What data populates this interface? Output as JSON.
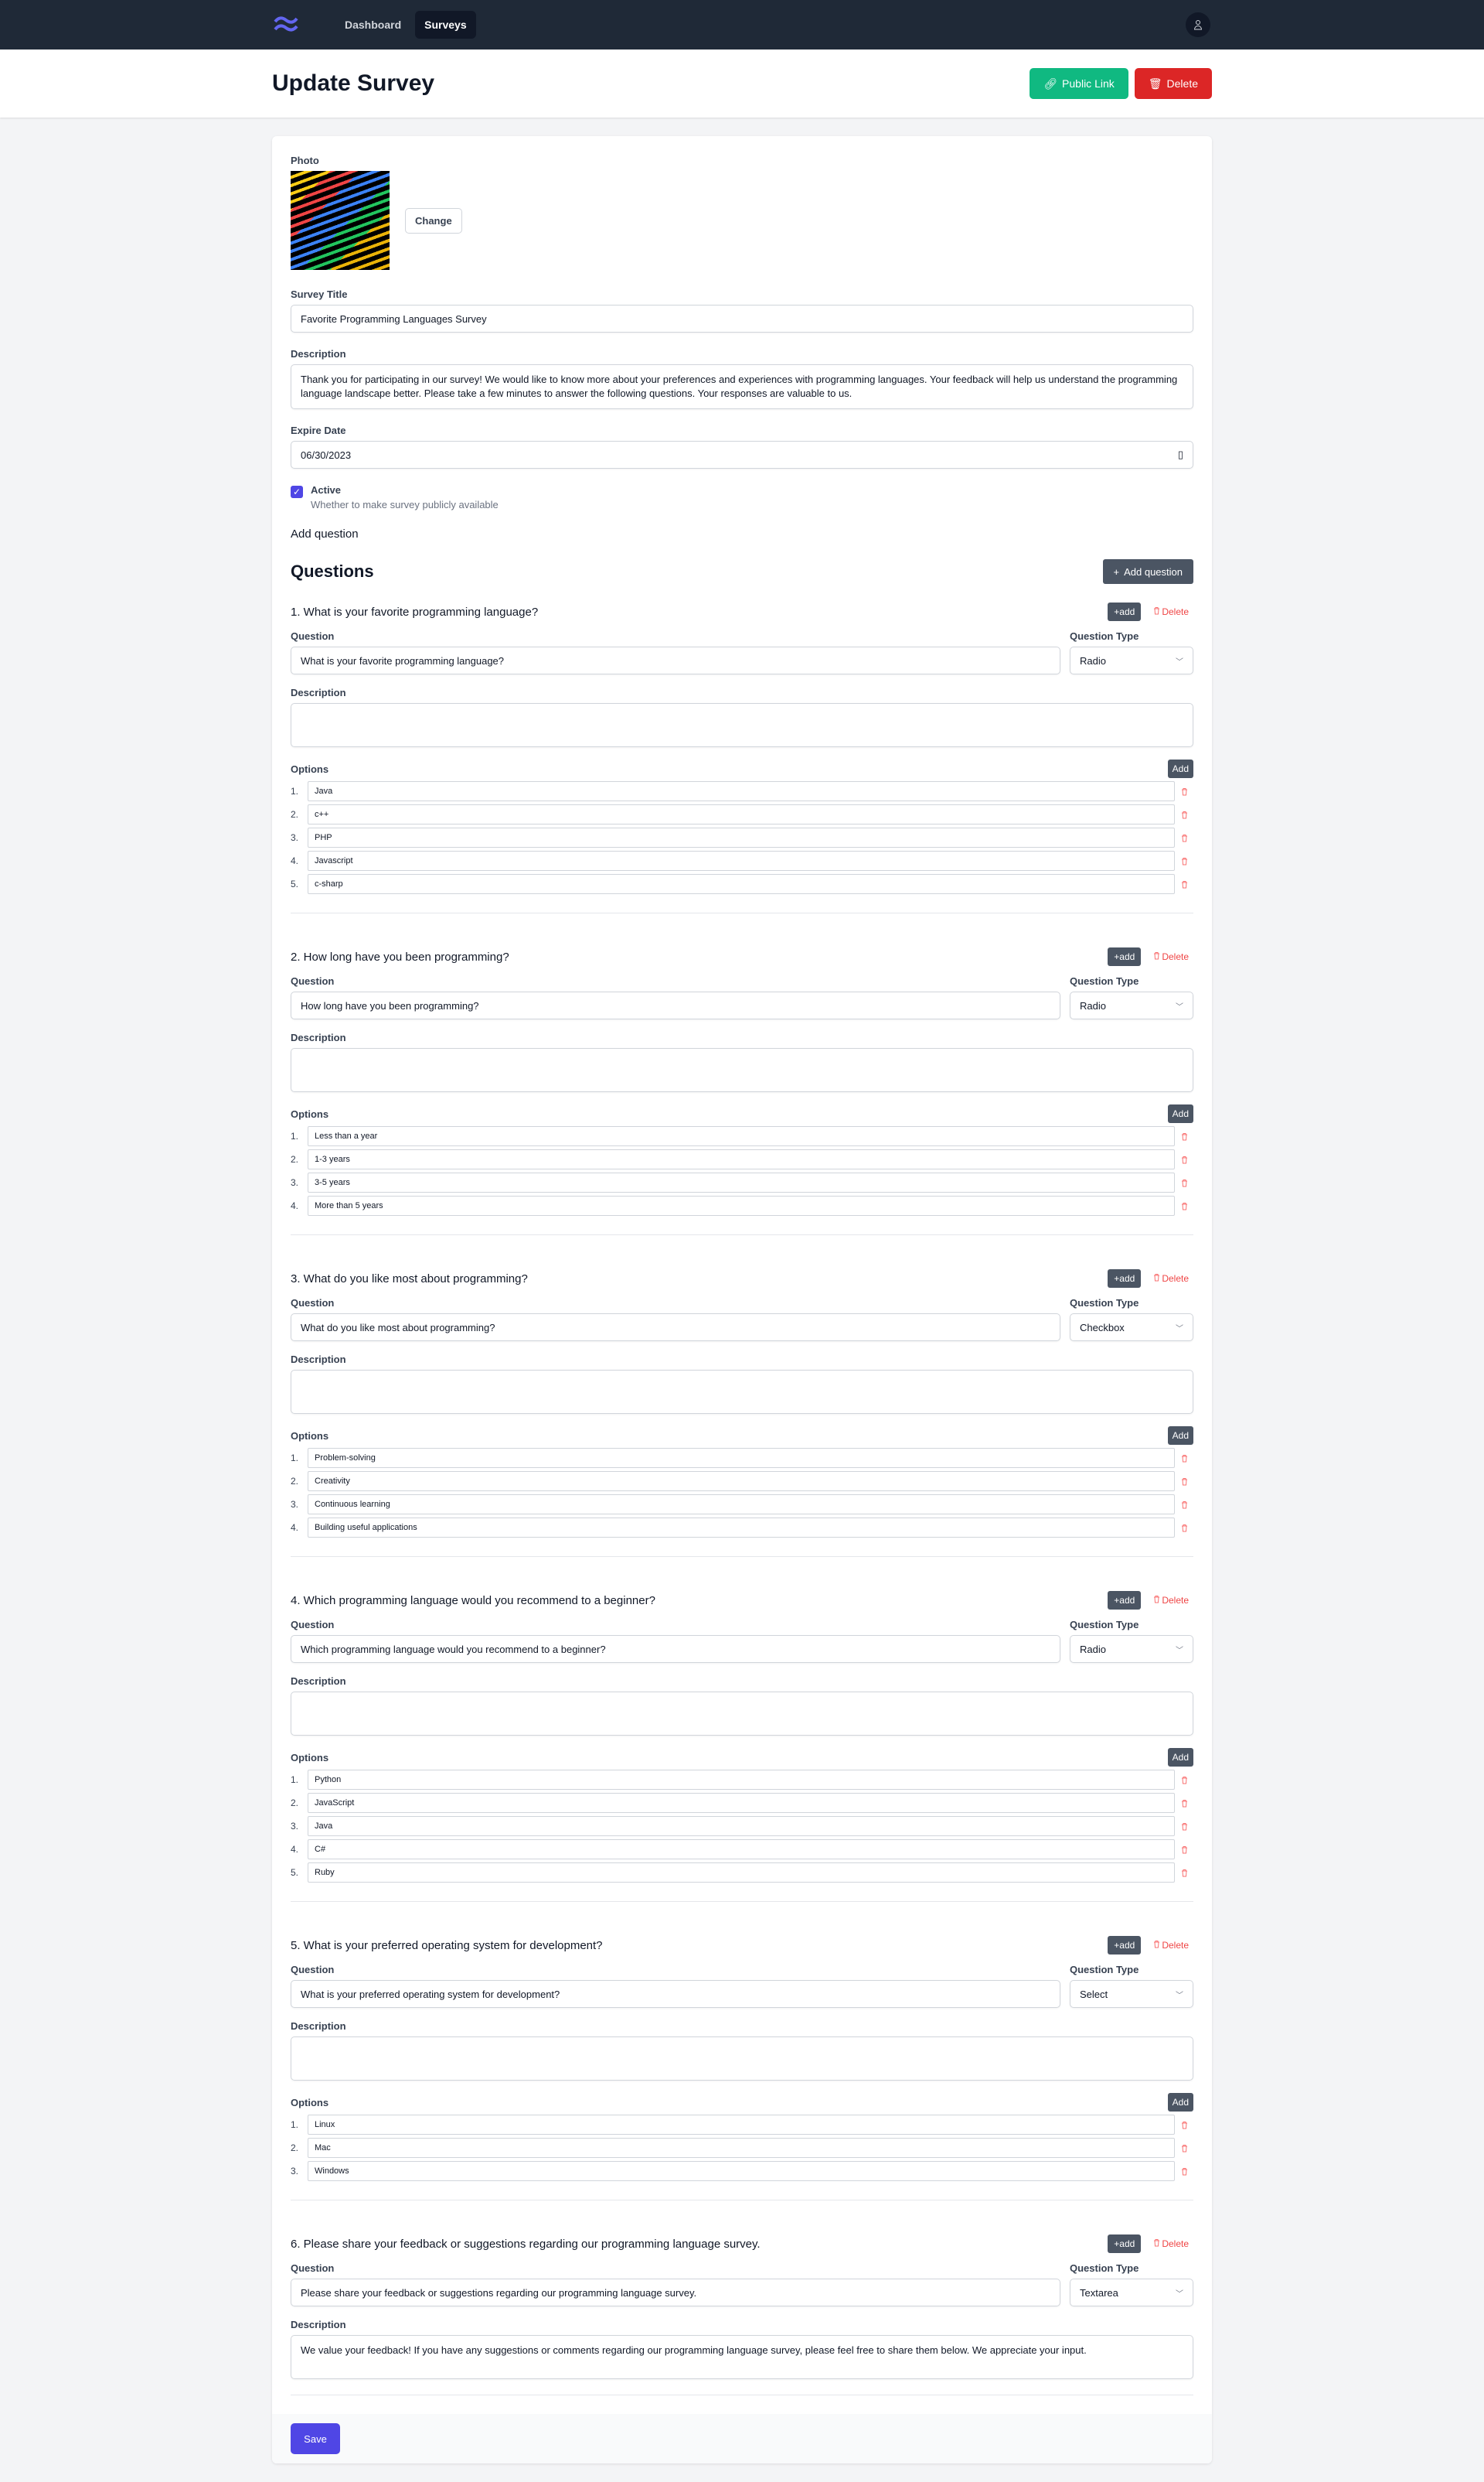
{
  "nav": {
    "items": [
      {
        "label": "Dashboard",
        "active": false
      },
      {
        "label": "Surveys",
        "active": true
      }
    ]
  },
  "header": {
    "title": "Update Survey",
    "public_link": "Public Link",
    "delete": "Delete"
  },
  "form": {
    "photo_label": "Photo",
    "change_label": "Change",
    "title_label": "Survey Title",
    "title_value": "Favorite Programming Languages Survey",
    "description_label": "Description",
    "description_value": "Thank you for participating in our survey! We would like to know more about your preferences and experiences with programming languages. Your feedback will help us understand the programming language landscape better. Please take a few minutes to answer the following questions. Your responses are valuable to us.",
    "expire_label": "Expire Date",
    "expire_value": "06/30/2023",
    "active_label": "Active",
    "active_checked": true,
    "active_help": "Whether to make survey publicly available",
    "add_question_text": "Add question"
  },
  "questions_section": {
    "heading": "Questions",
    "add_button": "Add question",
    "add_small": "add",
    "delete_small": "Delete",
    "question_label": "Question",
    "type_label": "Question Type",
    "description_label": "Description",
    "options_label": "Options",
    "add_option": "Add"
  },
  "questions": [
    {
      "title": "1. What is your favorite programming language?",
      "question": "What is your favorite programming language?",
      "type": "Radio",
      "description": "",
      "options": [
        "Java",
        "c++",
        "PHP",
        "Javascript",
        "c-sharp"
      ]
    },
    {
      "title": "2. How long have you been programming?",
      "question": "How long have you been programming?",
      "type": "Radio",
      "description": "",
      "options": [
        "Less than a year",
        "1-3 years",
        "3-5 years",
        "More than 5 years"
      ]
    },
    {
      "title": "3. What do you like most about programming?",
      "question": "What do you like most about programming?",
      "type": "Checkbox",
      "description": "",
      "options": [
        "Problem-solving",
        "Creativity",
        "Continuous learning",
        "Building useful applications"
      ]
    },
    {
      "title": "4. Which programming language would you recommend to a beginner?",
      "question": "Which programming language would you recommend to a beginner?",
      "type": "Radio",
      "description": "",
      "options": [
        "Python",
        "JavaScript",
        "Java",
        "C#",
        "Ruby"
      ]
    },
    {
      "title": "5. What is your preferred operating system for development?",
      "question": "What is your preferred operating system for development?",
      "type": "Select",
      "description": "",
      "options": [
        "Linux",
        "Mac",
        "Windows"
      ]
    },
    {
      "title": "6. Please share your feedback or suggestions regarding our programming language survey.",
      "question": "Please share your feedback or suggestions regarding our programming language survey.",
      "type": "Textarea",
      "description": "We value your feedback! If you have any suggestions or comments regarding our programming language survey, please feel free to share them below. We appreciate your input.",
      "options": []
    }
  ],
  "save_label": "Save",
  "colors": {
    "nav": "#1f2937",
    "primary": "#4f46e5",
    "green": "#10b981",
    "red": "#dc2626",
    "dark_button": "#4b5563"
  }
}
